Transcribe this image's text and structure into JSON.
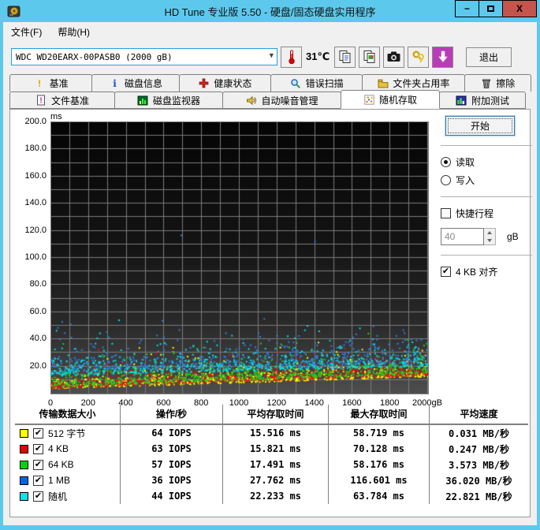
{
  "window": {
    "title": "HD Tune 专业版 5.50 - 硬盘/固态硬盘实用程序",
    "minimize_glyph": "−",
    "close_glyph": "X"
  },
  "menu": {
    "items": [
      "文件(F)",
      "帮助(H)"
    ]
  },
  "toolbar": {
    "drive_select": "WDC WD20EARX-00PASB0  (2000 gB)",
    "temperature": "31℃",
    "exit_label": "退出"
  },
  "tabs": {
    "row1": [
      {
        "label": "基准",
        "icon": "benchmark-icon"
      },
      {
        "label": "磁盘信息",
        "icon": "disk-info-icon"
      },
      {
        "label": "健康状态",
        "icon": "health-icon"
      },
      {
        "label": "错误扫描",
        "icon": "error-scan-icon"
      },
      {
        "label": "文件夹占用率",
        "icon": "folder-usage-icon"
      },
      {
        "label": "擦除",
        "icon": "erase-icon"
      }
    ],
    "row2": [
      {
        "label": "文件基准",
        "icon": "file-benchmark-icon"
      },
      {
        "label": "磁盘监视器",
        "icon": "disk-monitor-icon"
      },
      {
        "label": "自动噪音管理",
        "icon": "aam-icon"
      },
      {
        "label": "随机存取",
        "icon": "random-access-icon",
        "active": true
      },
      {
        "label": "附加测试",
        "icon": "extra-tests-icon"
      }
    ]
  },
  "controls": {
    "start_label": "开始",
    "read_label": "读取",
    "read_selected": true,
    "write_label": "写入",
    "write_selected": false,
    "short_stroke_label": "快捷行程",
    "short_stroke_checked": false,
    "short_stroke_value": "40",
    "short_stroke_unit": "gB",
    "align_label": "4 KB 对齐",
    "align_checked": true,
    "check_glyph": "✔"
  },
  "chart_data": {
    "type": "scatter",
    "title": "随机存取时间散点图",
    "x_unit": "gB",
    "y_unit": "ms",
    "xlim": [
      0,
      2000
    ],
    "ylim": [
      0,
      200
    ],
    "x_tick_step": 200,
    "y_tick_step": 20,
    "grid_x_step": 100,
    "grid_y_step": 10,
    "grid": true,
    "legend_position": "bottom-table",
    "series": [
      {
        "name": "512 字节",
        "color": "#ffff00",
        "iops": 64,
        "avg_ms": 15.516,
        "max_ms": 58.719,
        "count": 700,
        "floor_start": 3.5,
        "floor_end": 12.5,
        "tail": 4.5
      },
      {
        "name": "4 KB",
        "color": "#e81212",
        "iops": 63,
        "avg_ms": 15.821,
        "max_ms": 70.128,
        "count": 700,
        "floor_start": 4.0,
        "floor_end": 13.5,
        "tail": 4.5
      },
      {
        "name": "64 KB",
        "color": "#1ad01a",
        "iops": 57,
        "avg_ms": 17.491,
        "max_ms": 58.176,
        "count": 650,
        "floor_start": 5.0,
        "floor_end": 14.5,
        "tail": 5.0
      },
      {
        "name": "1 MB",
        "color": "#2f7fe8",
        "iops": 36,
        "avg_ms": 27.762,
        "max_ms": 116.601,
        "count": 560,
        "floor_start": 16.0,
        "floor_end": 22.0,
        "tail": 6.5,
        "outliers": [
          [
            690,
            116.6
          ],
          [
            1400,
            112.0
          ]
        ]
      },
      {
        "name": "随机",
        "color": "#00e0e8",
        "iops": 44,
        "avg_ms": 22.233,
        "max_ms": 63.784,
        "count": 620,
        "floor_start": 13.0,
        "floor_end": 20.0,
        "tail": 6.0
      }
    ]
  },
  "table": {
    "headers": [
      "传输数据大小",
      "操作/秒",
      "平均存取时间",
      "最大存取时间",
      "平均速度"
    ],
    "rows": [
      {
        "color": "#ffff00",
        "checked": true,
        "label": "512 字节",
        "ops": "64 IOPS",
        "avg": "15.516 ms",
        "max": "58.719 ms",
        "speed": "0.031 MB/秒"
      },
      {
        "color": "#e80000",
        "checked": true,
        "label": "4 KB",
        "ops": "63 IOPS",
        "avg": "15.821 ms",
        "max": "70.128 ms",
        "speed": "0.247 MB/秒"
      },
      {
        "color": "#00d400",
        "checked": true,
        "label": "64 KB",
        "ops": "57 IOPS",
        "avg": "17.491 ms",
        "max": "58.176 ms",
        "speed": "3.573 MB/秒"
      },
      {
        "color": "#0066e0",
        "checked": true,
        "label": "1 MB",
        "ops": "36 IOPS",
        "avg": "27.762 ms",
        "max": "116.601 ms",
        "speed": "36.020 MB/秒"
      },
      {
        "color": "#00e8e8",
        "checked": true,
        "label": "随机",
        "ops": "44 IOPS",
        "avg": "22.233 ms",
        "max": "63.784 ms",
        "speed": "22.821 MB/秒"
      }
    ]
  }
}
